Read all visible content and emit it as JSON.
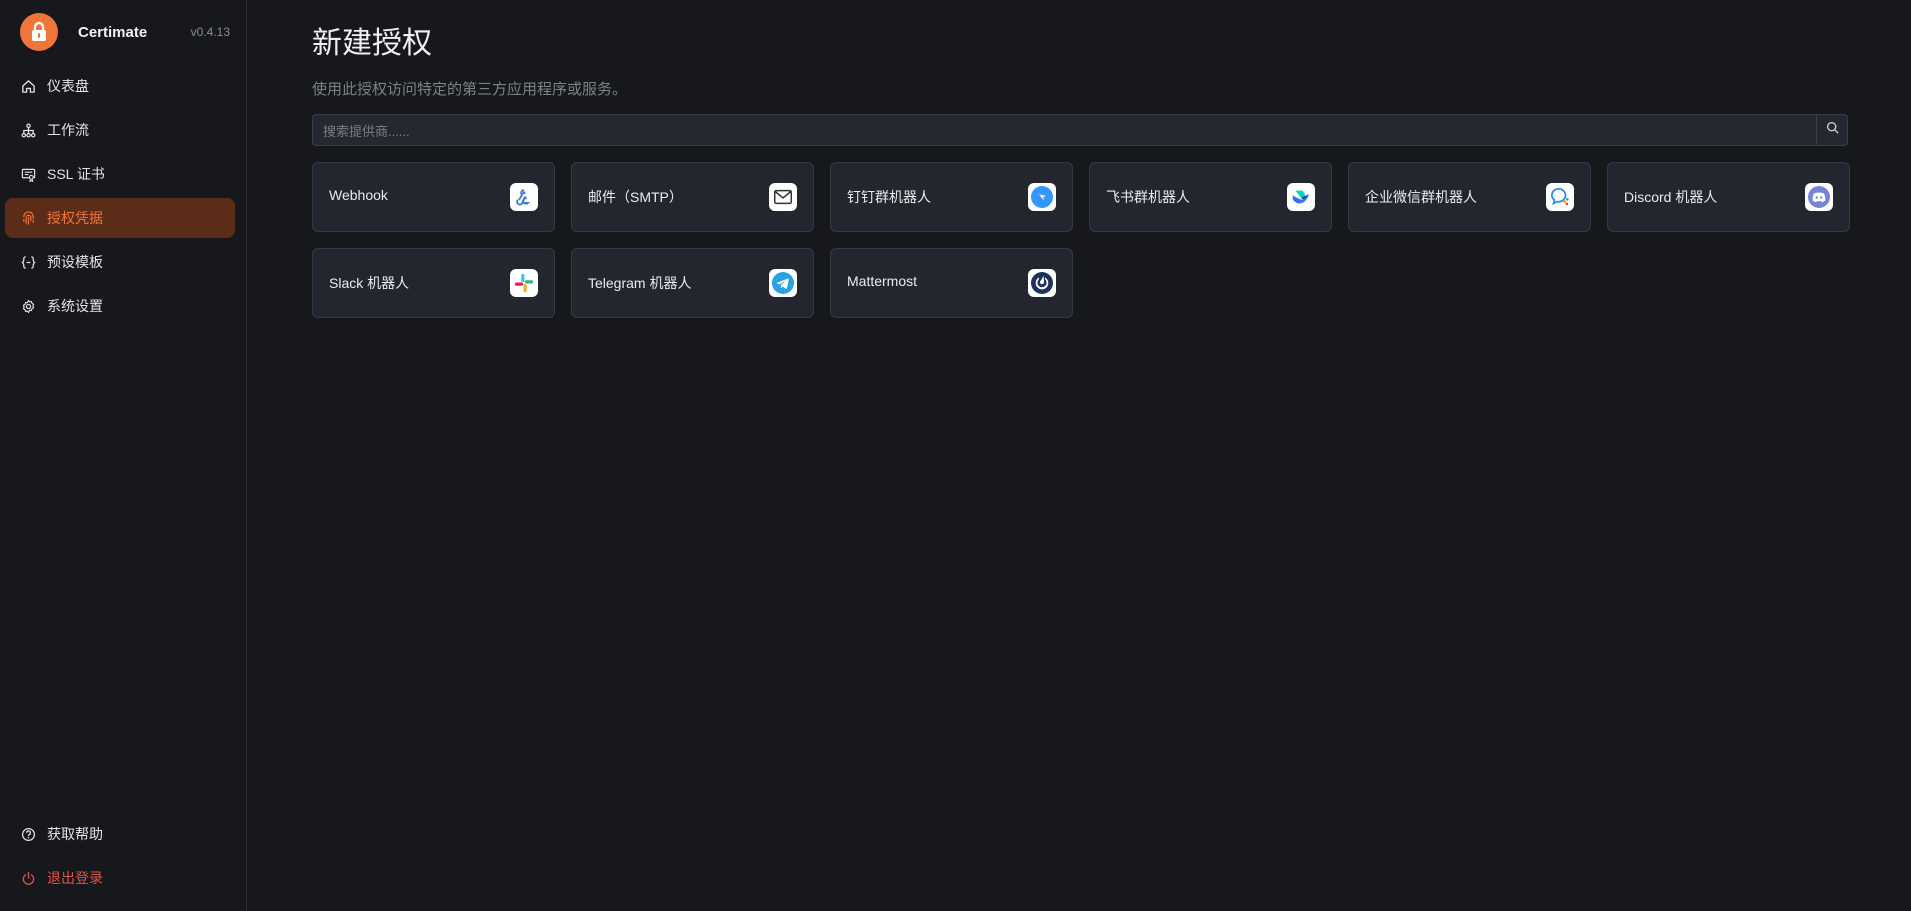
{
  "brand": {
    "name": "Certimate",
    "version": "v0.4.13",
    "accent": "#f0753a"
  },
  "nav": {
    "items": [
      {
        "label": "仪表盘",
        "icon": "home-icon"
      },
      {
        "label": "工作流",
        "icon": "workflow-icon"
      },
      {
        "label": "SSL 证书",
        "icon": "certificate-icon"
      },
      {
        "label": "授权凭据",
        "icon": "fingerprint-icon",
        "active": true
      },
      {
        "label": "预设模板",
        "icon": "braces-icon"
      },
      {
        "label": "系统设置",
        "icon": "gear-icon"
      }
    ],
    "bottom": [
      {
        "label": "获取帮助",
        "icon": "help-icon"
      },
      {
        "label": "退出登录",
        "icon": "power-icon"
      }
    ]
  },
  "main": {
    "title": "新建授权",
    "description": "使用此授权访问特定的第三方应用程序或服务。",
    "search": {
      "placeholder": "搜索提供商......",
      "value": ""
    }
  },
  "providers": [
    {
      "label": "Webhook",
      "icon": "webhook-icon"
    },
    {
      "label": "邮件（SMTP）",
      "icon": "mail-icon"
    },
    {
      "label": "钉钉群机器人",
      "icon": "dingtalk-icon"
    },
    {
      "label": "飞书群机器人",
      "icon": "lark-icon"
    },
    {
      "label": "企业微信群机器人",
      "icon": "wecom-icon"
    },
    {
      "label": "Discord 机器人",
      "icon": "discord-icon"
    },
    {
      "label": "Slack 机器人",
      "icon": "slack-icon"
    },
    {
      "label": "Telegram 机器人",
      "icon": "telegram-icon"
    },
    {
      "label": "Mattermost",
      "icon": "mattermost-icon"
    }
  ]
}
